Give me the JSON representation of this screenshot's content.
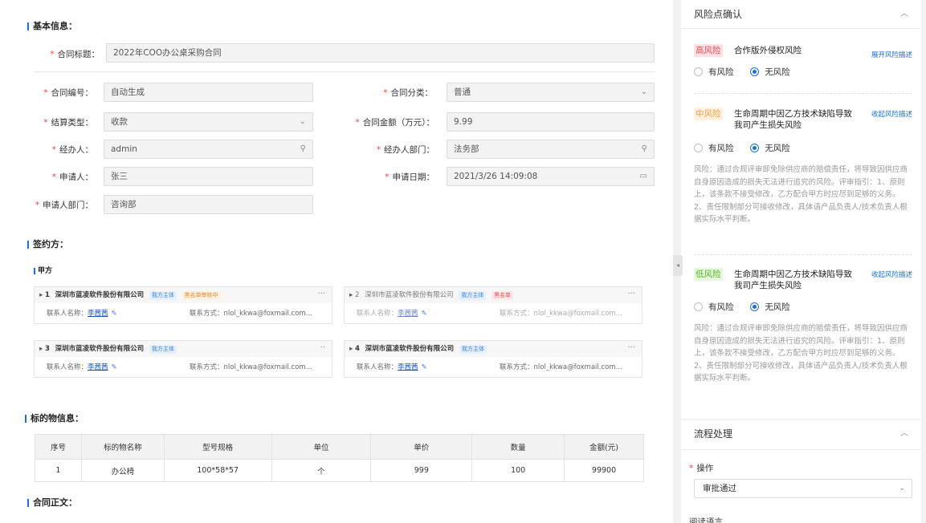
{
  "basic": {
    "title": "基本信息：",
    "contract_title_label": "合同标题：",
    "contract_title_value": "2022年COO办公桌采购合同",
    "contract_no_label": "合同编号：",
    "contract_no_value": "自动生成",
    "category_label": "合同分类：",
    "category_value": "普通",
    "settle_label": "结算类型：",
    "settle_value": "收款",
    "amount_label": "合同金额（万元）：",
    "amount_value": "9.99",
    "handler_label": "经办人：",
    "handler_value": "admin",
    "dept_label": "经办人部门：",
    "dept_value": "法务部",
    "applicant_label": "申请人：",
    "applicant_value": "张三",
    "apply_date_label": "申请日期：",
    "apply_date_value": "2021/3/26 14:09:08",
    "applicant_dept_label": "申请人部门：",
    "applicant_dept_value": "咨询部"
  },
  "signing": {
    "title": "签约方：",
    "party_a_label": "甲方",
    "contact_name_label": "联系人名称：",
    "contact_way_label": "联系方式：",
    "cards": [
      {
        "num": "1",
        "company": "深圳市蓝凌软件股份有限公司",
        "tags": [
          "我方主体",
          "黑名单审核中"
        ],
        "contact": "李茜茜",
        "email": "nlol_kkwa@foxmail.com..."
      },
      {
        "num": "2",
        "company": "深圳市蓝凌软件股份有限公司",
        "tags": [
          "我方主体",
          "黑名单"
        ],
        "contact": "李茜茜",
        "email": "nlol_kkwa@foxmail.com..."
      },
      {
        "num": "3",
        "company": "深圳市蓝凌软件股份有限公司",
        "tags": [
          "我方主体"
        ],
        "contact": "李茜茜",
        "email": "nlol_kkwa@foxmail.com..."
      },
      {
        "num": "4",
        "company": "深圳市蓝凌软件股份有限公司",
        "tags": [
          "我方主体"
        ],
        "contact": "李茜茜",
        "email": "nlol_kkwa@foxmail.com..."
      }
    ]
  },
  "subject": {
    "title": "标的物信息：",
    "headers": [
      "序号",
      "标的物名称",
      "型号规格",
      "单位",
      "单价",
      "数量",
      "金额(元)"
    ],
    "rows": [
      [
        "1",
        "办公椅",
        "100*58*57",
        "个",
        "999",
        "100",
        "99900"
      ]
    ]
  },
  "body_section": {
    "title": "合同正文："
  },
  "risk_panel": {
    "title": "风险点确认",
    "option_yes": "有风险",
    "option_no": "无风险",
    "items": [
      {
        "level": "高风险",
        "name": "合作版外侵权风险",
        "link": "展开风险描述",
        "desc": ""
      },
      {
        "level": "中风险",
        "name": "生命周期中因乙方技术缺陷导致我司产生损失风险",
        "link": "收起风险描述",
        "desc": "风险：通过合规评审即免除供应商的赔偿责任，将导致因供应商自身原因造成的损失无法进行追究的风险。评审指引：1、原则上，该条款不接受修改，乙方配合甲方时应尽到足够的义务。2、责任限制部分可接收修改，具体请产品负责人/技术负责人根据实际水平判断。"
      },
      {
        "level": "低风险",
        "name": "生命周期中因乙方技术缺陷导致我司产生损失风险",
        "link": "收起风险描述",
        "desc": "风险：通过合规评审即免除供应商的赔偿责任，将导致因供应商自身原因造成的损失无法进行追究的风险。评审指引：1、原则上，该条款不接受修改，乙方配合甲方时应尽到足够的义务。2、责任限制部分可接收修改，具体请产品负责人/技术负责人根据实际水平判断。"
      }
    ]
  },
  "flow_panel": {
    "title": "流程处理",
    "op_label": "操作",
    "op_value": "审批通过",
    "next_label": "阅读语言"
  }
}
